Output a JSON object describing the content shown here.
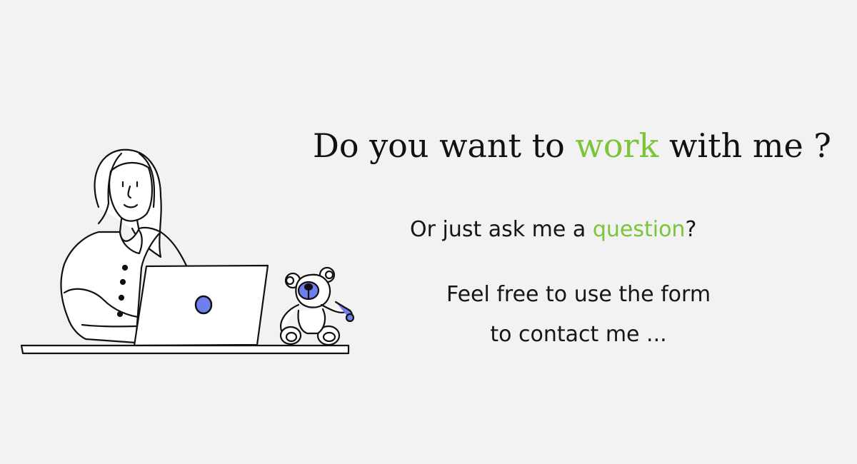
{
  "headline": {
    "before": "Do you want to ",
    "accent": "work",
    "after": " with me ?"
  },
  "subline": {
    "before": "Or just ask me a ",
    "accent": "question",
    "after": "?"
  },
  "invite": {
    "line1": "Feel free to use the form",
    "line2": "to contact me ..."
  },
  "colors": {
    "accent": "#7cc43a",
    "text": "#111111",
    "background": "#f2f2f2",
    "laptop_logo": "#6f7ff0"
  },
  "illustration": {
    "icons": [
      "woman-at-laptop-illustration",
      "teddy-bear-icon"
    ]
  }
}
